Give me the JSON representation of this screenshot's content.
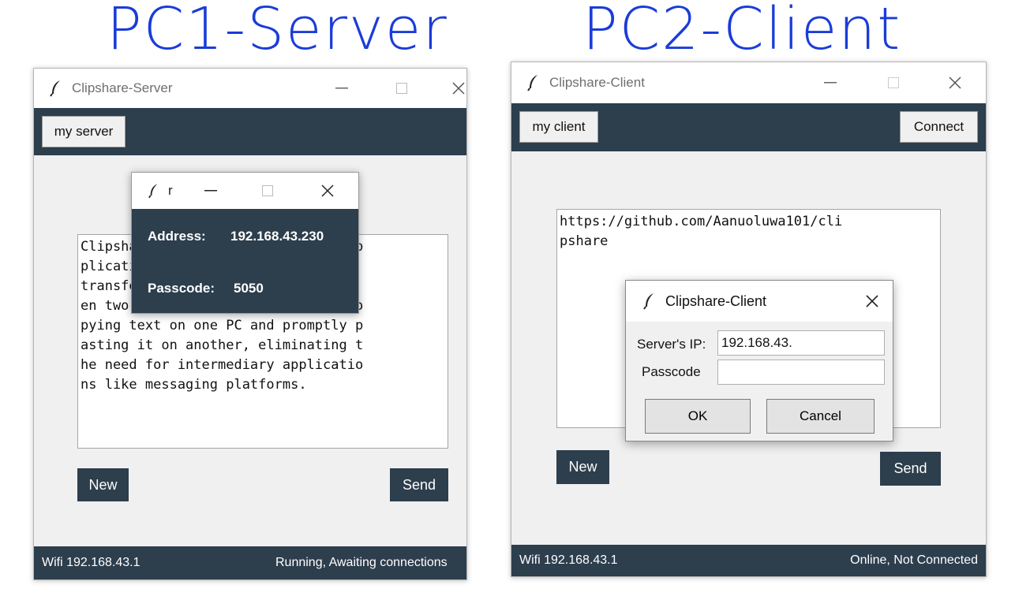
{
  "annotations": {
    "left": "PC1-Server",
    "right": "PC2-Client"
  },
  "server_window": {
    "title": "Clipshare-Server",
    "toolbar_button": "my server",
    "text": "Clipshare is a clipboard sharing ap\nplication designed to simplify the \ntransfer of text content betwe\nen two PCs. Imagine effortlessly co\npying text on one PC and promptly p\nasting it on another, eliminating t\nhe need for intermediary applicatio\nns like messaging platforms.",
    "new_label": "New",
    "send_label": "Send",
    "status_left": "Wifi 192.168.43.1",
    "status_right": "Running, Awaiting connections"
  },
  "info_popup": {
    "title": "r",
    "address_label": "Address:",
    "address_value": "192.168.43.230",
    "passcode_label": "Passcode:",
    "passcode_value": "5050"
  },
  "client_window": {
    "title": "Clipshare-Client",
    "toolbar_button": "my client",
    "connect_label": "Connect",
    "text": "https://github.com/Aanuoluwa101/cli\npshare",
    "new_label": "New",
    "send_label": "Send",
    "status_left": "Wifi 192.168.43.1",
    "status_right": "Online, Not Connected"
  },
  "connect_dialog": {
    "title": "Clipshare-Client",
    "ip_label": "Server's IP:",
    "ip_value": "192.168.43.",
    "passcode_label": "Passcode",
    "passcode_value": "",
    "ok_label": "OK",
    "cancel_label": "Cancel"
  },
  "colors": {
    "dark": "#2d3e4d",
    "annotation": "#1a3cd8"
  },
  "icons": {
    "app": "feather-icon",
    "minimize": "minimize-icon",
    "maximize": "maximize-icon",
    "close": "close-icon"
  }
}
